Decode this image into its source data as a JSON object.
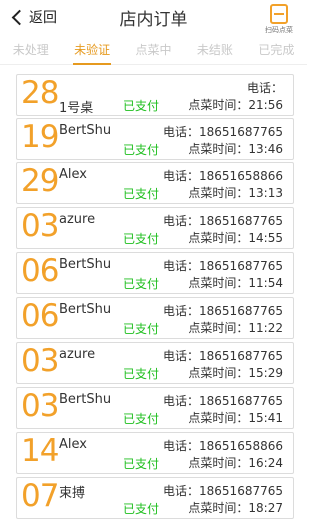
{
  "header": {
    "back_label": "返回",
    "title": "店内订单",
    "scan_label": "扫码点菜"
  },
  "tabs": [
    {
      "label": "未处理",
      "active": false
    },
    {
      "label": "未验证",
      "active": true
    },
    {
      "label": "点菜中",
      "active": false
    },
    {
      "label": "未结账",
      "active": false
    },
    {
      "label": "已完成",
      "active": false
    }
  ],
  "orders": [
    {
      "number": "28",
      "name": "1号桌",
      "status": "已支付",
      "phone": "电话：",
      "time": "点菜时间：21:56"
    },
    {
      "number": "19",
      "name": "BertShu",
      "status": "已支付",
      "phone": "电话：18651687765",
      "time": "点菜时间：13:46"
    },
    {
      "number": "29",
      "name": "Alex",
      "status": "已支付",
      "phone": "电话：18651658866",
      "time": "点菜时间：13:13"
    },
    {
      "number": "03",
      "name": "azure",
      "status": "已支付",
      "phone": "电话：18651687765",
      "time": "点菜时间：14:55"
    },
    {
      "number": "06",
      "name": "BertShu",
      "status": "已支付",
      "phone": "电话：18651687765",
      "time": "点菜时间：11:54"
    },
    {
      "number": "06",
      "name": "BertShu",
      "status": "已支付",
      "phone": "电话：18651687765",
      "time": "点菜时间：11:22"
    },
    {
      "number": "03",
      "name": "azure",
      "status": "已支付",
      "phone": "电话：18651687765",
      "time": "点菜时间：15:29"
    },
    {
      "number": "03",
      "name": "BertShu",
      "status": "已支付",
      "phone": "电话：18651687765",
      "time": "点菜时间：15:41"
    },
    {
      "number": "14",
      "name": "Alex",
      "status": "已支付",
      "phone": "电话：18651658866",
      "time": "点菜时间：16:24"
    },
    {
      "number": "07",
      "name": "束搏",
      "status": "已支付",
      "phone": "电话：18651687765",
      "time": "点菜时间：18:27"
    }
  ],
  "colors": {
    "accent": "#f2a12a",
    "paid": "#1fbf1f",
    "tab_inactive": "#c9c9c9"
  }
}
